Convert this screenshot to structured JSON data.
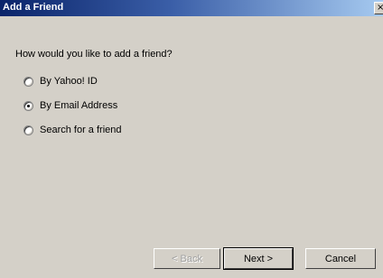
{
  "window": {
    "title": "Add a Friend",
    "close_glyph": "×"
  },
  "main": {
    "question": "How would you like to add a friend?",
    "options": [
      {
        "label": "By Yahoo! ID",
        "selected": false
      },
      {
        "label": "By Email Address",
        "selected": true
      },
      {
        "label": "Search for a friend",
        "selected": false
      }
    ]
  },
  "buttons": {
    "back": "< Back",
    "next": "Next >",
    "cancel": "Cancel"
  }
}
